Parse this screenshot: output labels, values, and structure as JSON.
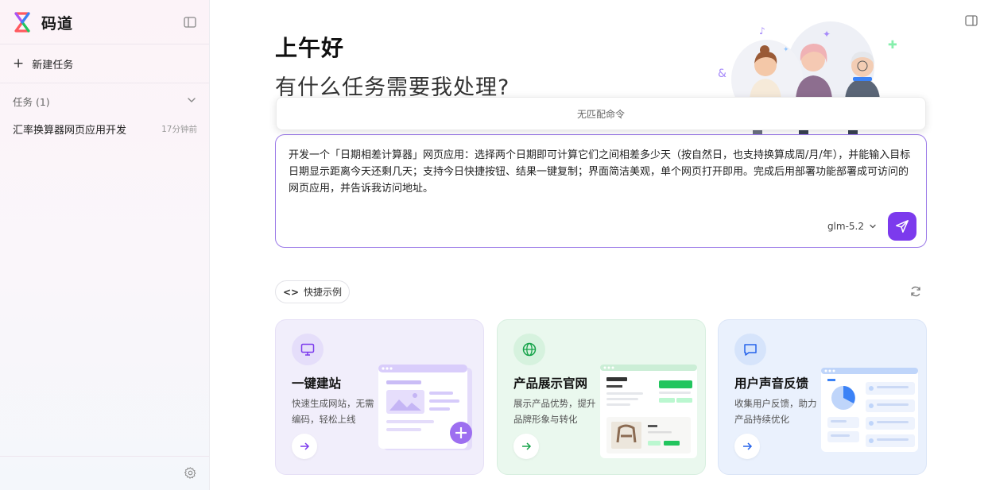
{
  "app": {
    "name": "码道"
  },
  "sidebar": {
    "new_task_label": "新建任务",
    "tasks_header": "任务 (1)",
    "tasks": [
      {
        "title": "汇率换算器网页应用开发",
        "time": "17分钟前"
      }
    ]
  },
  "main": {
    "greeting": "上午好",
    "question": "有什么任务需要我处理?",
    "command_popup_text": "无匹配命令",
    "input": {
      "value": "开发一个「日期相差计算器」网页应用：选择两个日期即可计算它们之间相差多少天（按自然日，也支持换算成周/月/年），并能输入目标日期显示距离今天还剩几天；支持今日快捷按钮、结果一键复制；界面简洁美观，单个网页打开即用。完成后用部署功能部署成可访问的网页应用，并告诉我访问地址。",
      "model": "glm-5.2"
    },
    "quick_examples_label": "快捷示例",
    "cards": [
      {
        "title": "一键建站",
        "desc": "快速生成网站，无需编码，轻松上线",
        "icon": "monitor-icon"
      },
      {
        "title": "产品展示官网",
        "desc": "展示产品优势，提升品牌形象与转化",
        "icon": "globe-icon"
      },
      {
        "title": "用户声音反馈",
        "desc": "收集用户反馈，助力产品持续优化",
        "icon": "chat-icon"
      }
    ]
  },
  "colors": {
    "accent": "#7c3aed",
    "input_border": "#9b7ae8"
  }
}
